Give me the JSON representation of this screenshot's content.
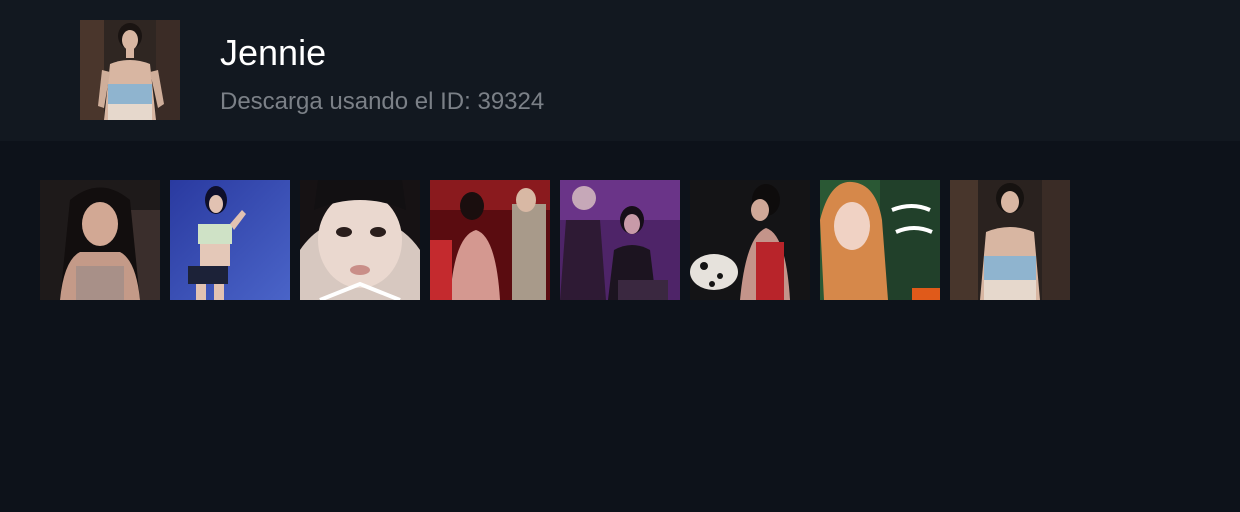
{
  "profile": {
    "name": "Jennie",
    "subtitle": "Descarga usando el ID: 39324",
    "avatar_icon": "profile-photo"
  },
  "gallery": {
    "items": [
      {
        "icon": "photo-thumbnail",
        "tone": "#3a2b24"
      },
      {
        "icon": "photo-thumbnail",
        "tone": "#3146a8"
      },
      {
        "icon": "photo-thumbnail",
        "tone": "#b0a8a2"
      },
      {
        "icon": "photo-thumbnail",
        "tone": "#7a1418"
      },
      {
        "icon": "photo-thumbnail",
        "tone": "#4a2260"
      },
      {
        "icon": "photo-thumbnail",
        "tone": "#1a1a1c"
      },
      {
        "icon": "photo-thumbnail",
        "tone": "#2e5a3a"
      },
      {
        "icon": "photo-thumbnail",
        "tone": "#2a2220"
      }
    ]
  },
  "colors": {
    "page_background": "#0d121a",
    "header_background": "#121820",
    "title": "#ffffff",
    "subtitle": "#7b8087"
  }
}
